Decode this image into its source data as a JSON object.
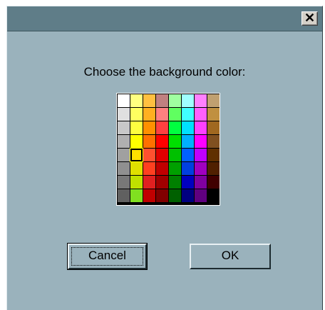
{
  "dialog": {
    "close_glyph": "✕",
    "prompt": "Choose the background color:",
    "cancel_label": "Cancel",
    "ok_label": "OK"
  },
  "palette": {
    "rows": 8,
    "columns": 8,
    "selected": {
      "row": 4,
      "column": 1
    },
    "colors": [
      [
        "#ffffff",
        "#ffff80",
        "#ffc040",
        "#c08080",
        "#a0ffa0",
        "#a0ffff",
        "#ff80ff",
        "#c0a070"
      ],
      [
        "#e0e0e0",
        "#ffff60",
        "#ffb020",
        "#ff8080",
        "#60ff60",
        "#40ffff",
        "#ff60ff",
        "#c09040"
      ],
      [
        "#c8c8c8",
        "#ffff40",
        "#ff9000",
        "#ff4040",
        "#00ff40",
        "#00e0ff",
        "#ff40ff",
        "#a06820"
      ],
      [
        "#b0b0b0",
        "#ffff00",
        "#ff7000",
        "#ff0000",
        "#00e000",
        "#00b0ff",
        "#ff00ff",
        "#805020"
      ],
      [
        "#a0a0a0",
        "#ffe000",
        "#ff5030",
        "#e00000",
        "#00c000",
        "#0060ff",
        "#c000ff",
        "#603000"
      ],
      [
        "#909090",
        "#e0e000",
        "#ff4020",
        "#c00000",
        "#00a000",
        "#0040e0",
        "#a000c0",
        "#502000"
      ],
      [
        "#787878",
        "#c0e000",
        "#e02020",
        "#a00000",
        "#008000",
        "#0000c0",
        "#8000a0",
        "#400000"
      ],
      [
        "#606060",
        "#80e020",
        "#c00000",
        "#800000",
        "#006000",
        "#000080",
        "#600080",
        "#000000"
      ]
    ]
  }
}
